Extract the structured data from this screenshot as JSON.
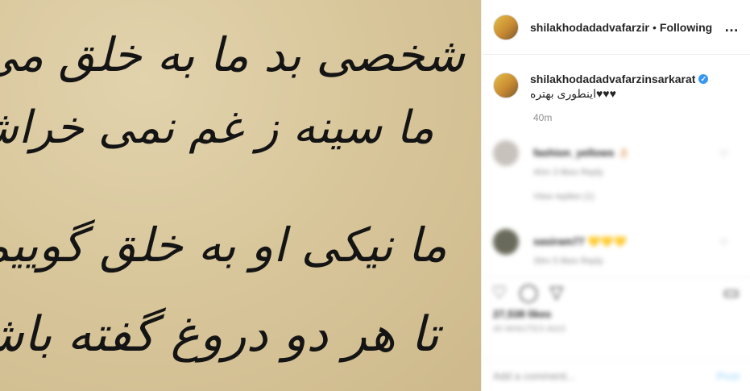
{
  "post": {
    "poem": [
      "شخصی بد ما به خلق می گفت",
      "ما سینه ز غم نمی خراشیم",
      "ما نیکی او به خلق گوییم",
      "تا هر دو دروغ گفته باشیم"
    ]
  },
  "header": {
    "username": "shilakhodadadvafarzinsarkarat",
    "separator": "•",
    "follow_label": "Following",
    "more_icon": "…"
  },
  "caption": {
    "username": "shilakhodadadvafarzinsarkarat",
    "verified_icon": "✓",
    "text": "♥♥♥اینطوری بهتره",
    "time": "40m"
  },
  "comments": [
    {
      "user": "fashion_yellows",
      "emoji": "👌🏻",
      "meta": "40m 3 likes Reply",
      "like_icon": "♡",
      "replies": "View replies (1)"
    },
    {
      "user": "sasiram77",
      "emoji": "💛💛💛",
      "meta": "39m 5 likes Reply",
      "like_icon": "♡"
    }
  ],
  "actions": {
    "like_icon": "♡",
    "comment_icon": "◯",
    "share_icon": "▽",
    "save_icon": "▭",
    "likes_text": "27,538 likes",
    "time_ago": "40 MINUTES AGO"
  },
  "add_comment": {
    "placeholder": "Add a comment...",
    "post_label": "Post"
  }
}
